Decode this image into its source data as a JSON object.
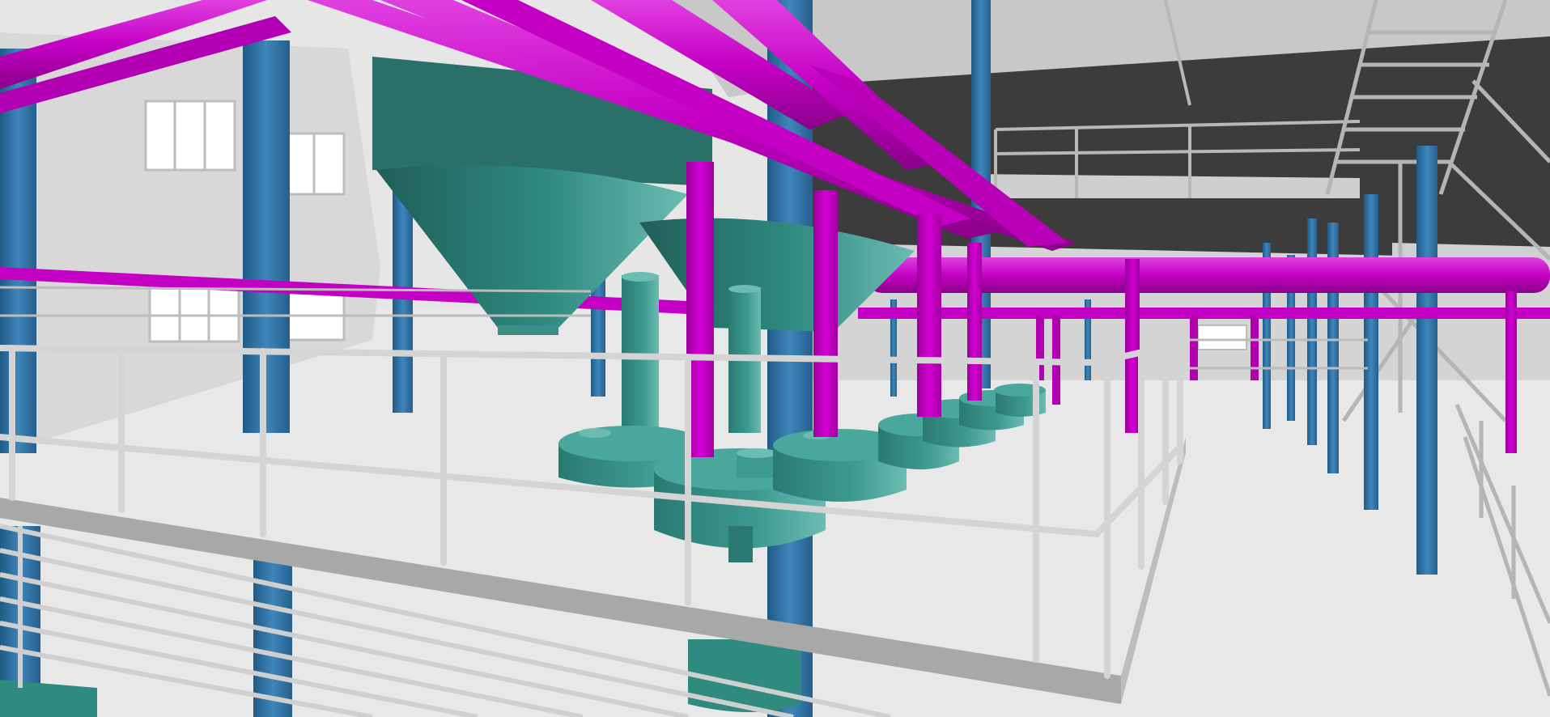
{
  "scene": {
    "description_free": true,
    "colors": {
      "pipe": "#c400c4",
      "pipe_highlight": "#e84de8",
      "column": "#2e6f9e",
      "column_light": "#4a8fc2",
      "tank": "#2f8a80",
      "tank_light": "#5fb3aa",
      "tank_dark": "#1f5f58",
      "railing": "#d2d2d2",
      "railing_dark": "#9a9a9a",
      "wall": "#d9d9d9",
      "floor": "#e8e8e8",
      "ceiling": "#c4c4c4",
      "ceiling_dark": "#3a3a3a",
      "window": "#ffffff"
    },
    "icons": [
      "hopper-tank",
      "pump-unit",
      "pipe-run",
      "steel-column",
      "guard-railing",
      "stair-flight"
    ]
  }
}
